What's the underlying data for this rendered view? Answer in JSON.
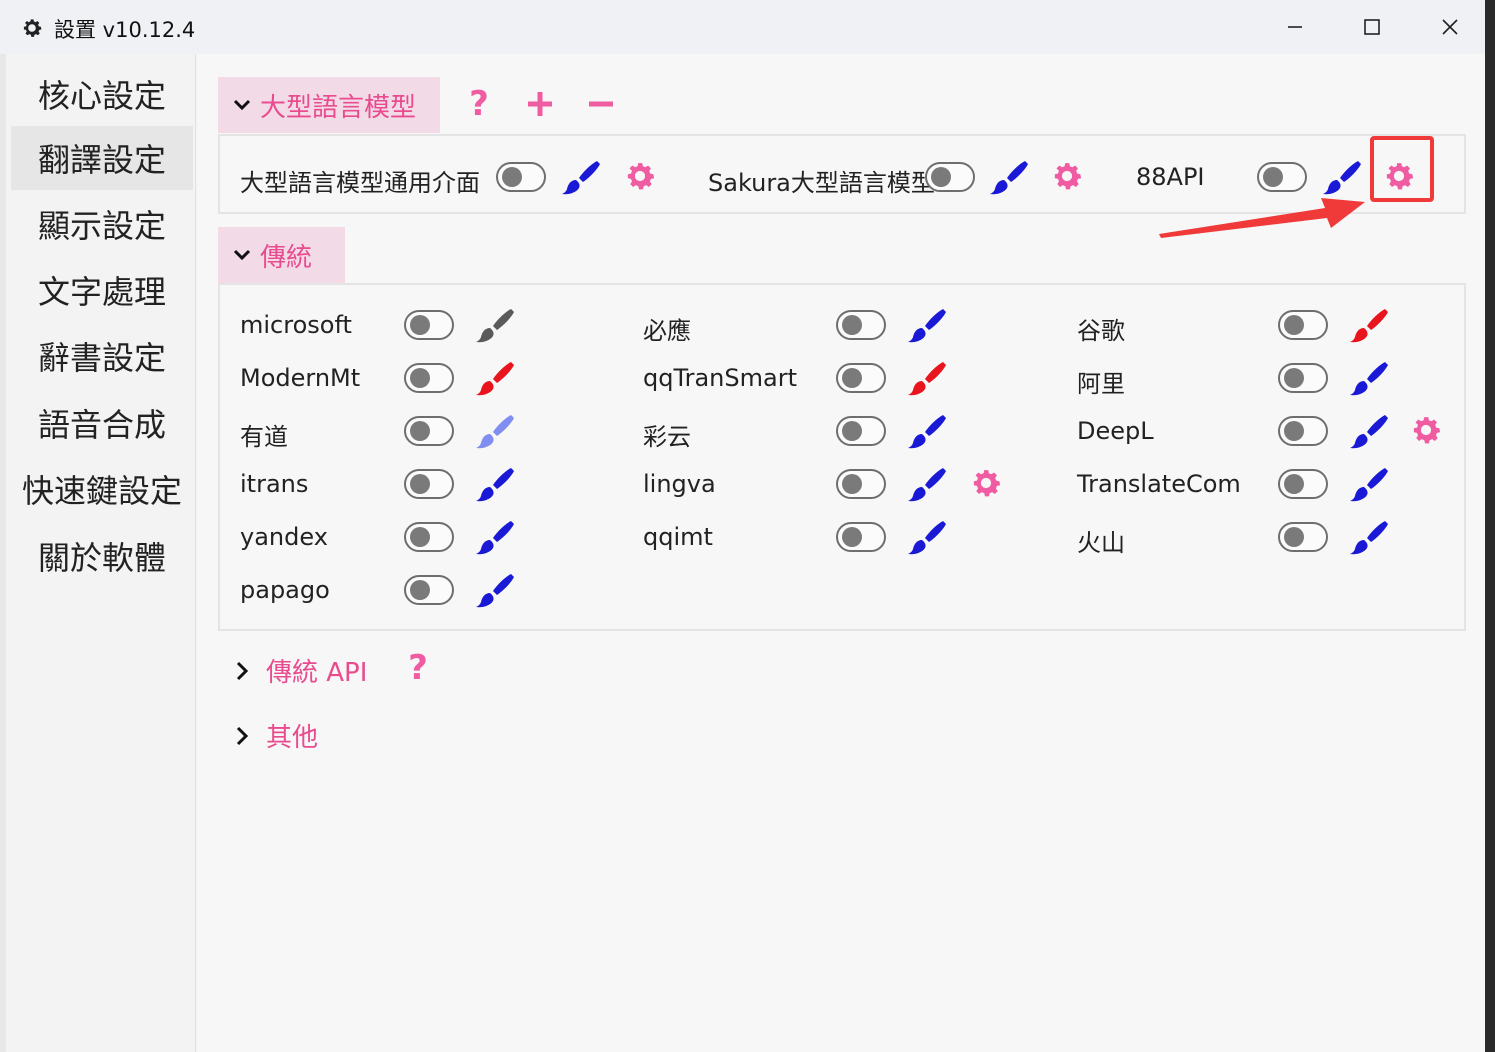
{
  "window": {
    "title": "設置 v10.12.4",
    "icon": "gear-icon",
    "controls": [
      "minimize-icon",
      "maximize-icon",
      "close-icon"
    ]
  },
  "sidebar": {
    "items": [
      {
        "label": "核心設定",
        "active": false
      },
      {
        "label": "翻譯設定",
        "active": true
      },
      {
        "label": "顯示設定",
        "active": false
      },
      {
        "label": "文字處理",
        "active": false
      },
      {
        "label": "辭書設定",
        "active": false
      },
      {
        "label": "語音合成",
        "active": false
      },
      {
        "label": "快速鍵設定",
        "active": false
      },
      {
        "label": "關於軟體",
        "active": false
      }
    ]
  },
  "llm_group": {
    "title": "大型語言模型",
    "actions": [
      "help-icon",
      "add-icon",
      "remove-icon"
    ],
    "action_glyphs": [
      "?",
      "+",
      "−"
    ],
    "items": [
      {
        "label": "大型語言模型通用介面",
        "enabled": false,
        "brush_color": "#1a1ad6",
        "has_settings": true
      },
      {
        "label": "Sakura大型語言模型",
        "enabled": false,
        "brush_color": "#1a1ad6",
        "has_settings": true
      },
      {
        "label": "88API",
        "enabled": false,
        "brush_color": "#1a1ad6",
        "has_settings": true
      }
    ]
  },
  "traditional_group": {
    "title": "傳統",
    "items": [
      {
        "label": "microsoft",
        "enabled": false,
        "brush_color": "#5a5a5a",
        "has_settings": false
      },
      {
        "label": "必應",
        "enabled": false,
        "brush_color": "#1a1ad6",
        "has_settings": false
      },
      {
        "label": "谷歌",
        "enabled": false,
        "brush_color": "#e8141e",
        "has_settings": false
      },
      {
        "label": "ModernMt",
        "enabled": false,
        "brush_color": "#e8141e",
        "has_settings": false
      },
      {
        "label": "qqTranSmart",
        "enabled": false,
        "brush_color": "#e8141e",
        "has_settings": false
      },
      {
        "label": "阿里",
        "enabled": false,
        "brush_color": "#1a1ad6",
        "has_settings": false
      },
      {
        "label": "有道",
        "enabled": false,
        "brush_color": "#7f8ef0",
        "has_settings": false
      },
      {
        "label": "彩云",
        "enabled": false,
        "brush_color": "#1a1ad6",
        "has_settings": false
      },
      {
        "label": "DeepL",
        "enabled": false,
        "brush_color": "#1a1ad6",
        "has_settings": true
      },
      {
        "label": "itrans",
        "enabled": false,
        "brush_color": "#1a1ad6",
        "has_settings": false
      },
      {
        "label": "lingva",
        "enabled": false,
        "brush_color": "#1a1ad6",
        "has_settings": true
      },
      {
        "label": "TranslateCom",
        "enabled": false,
        "brush_color": "#1a1ad6",
        "has_settings": false
      },
      {
        "label": "yandex",
        "enabled": false,
        "brush_color": "#1a1ad6",
        "has_settings": false
      },
      {
        "label": "qqimt",
        "enabled": false,
        "brush_color": "#1a1ad6",
        "has_settings": false
      },
      {
        "label": "火山",
        "enabled": false,
        "brush_color": "#1a1ad6",
        "has_settings": false
      },
      {
        "label": "papago",
        "enabled": false,
        "brush_color": "#1a1ad6",
        "has_settings": false
      }
    ]
  },
  "collapsed_groups": [
    {
      "title": "傳統 API",
      "has_help": true,
      "help_glyph": "?"
    },
    {
      "title": "其他",
      "has_help": false
    }
  ],
  "colors": {
    "accent_pink": "#e94b8f",
    "gear_pink": "#f05ca2",
    "group_header_bg": "#f2dbe7",
    "annotation_red": "#f03a3a"
  }
}
